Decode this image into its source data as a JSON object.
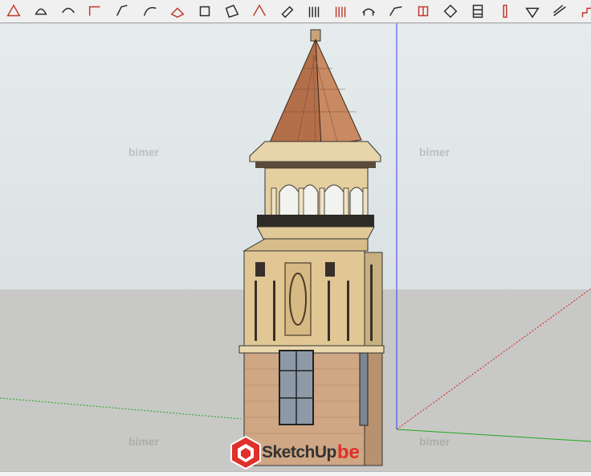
{
  "app": {
    "name": "SketchUp"
  },
  "toolbar": {
    "tools": [
      {
        "name": "select-tool-icon"
      },
      {
        "name": "paint-bucket-icon"
      },
      {
        "name": "rotate-icon"
      },
      {
        "name": "line-tool-icon"
      },
      {
        "name": "freehand-tool-icon"
      },
      {
        "name": "arc-tool-icon"
      },
      {
        "name": "follow-me-icon"
      },
      {
        "name": "push-pull-icon"
      },
      {
        "name": "offset-icon"
      },
      {
        "name": "sandbox-icon"
      },
      {
        "name": "eraser-icon"
      },
      {
        "name": "stairs-icon"
      },
      {
        "name": "railing-icon"
      },
      {
        "name": "handrail-icon"
      },
      {
        "name": "roof-icon"
      },
      {
        "name": "window-icon"
      },
      {
        "name": "wall-icon"
      },
      {
        "name": "structure-icon"
      },
      {
        "name": "column-icon"
      },
      {
        "name": "beam-icon"
      },
      {
        "name": "pipe-icon"
      },
      {
        "name": "staircase-icon"
      }
    ]
  },
  "watermarks": [
    "bimer",
    "bimer",
    "bimer",
    "bimer"
  ],
  "logo": {
    "text": "SketchUp",
    "suffix": "be"
  },
  "colors": {
    "sky": "#e6ecee",
    "ground": "#c8c8c6",
    "roof": "#b7744f",
    "stone": "#dcc59a",
    "brick": "#cda582",
    "axis_blue": "#3a3aff",
    "axis_green": "#1ea81e",
    "axis_red": "#d42020",
    "logo_red": "#e0302a"
  }
}
